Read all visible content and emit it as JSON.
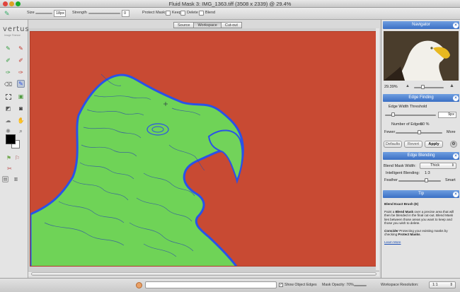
{
  "window": {
    "title": "Fluid Mask 3: IMG_1363.tiff (3508 x 2339) @ 29.4%"
  },
  "options_bar": {
    "size_label": "Size",
    "size_value": "18px",
    "strength_label": "Strength",
    "strength_value": "0",
    "protect_mask_label": "Protect Mask:",
    "keep_label": "Keep",
    "delete_label": "Delete",
    "blend_label": "Blend"
  },
  "toolbox": {
    "logo": "vertus",
    "logo_sub": "Image Finesse",
    "tools": [
      "green-brush-icon",
      "red-brush-icon",
      "green-brush-alt-icon",
      "red-brush-alt-icon",
      "green-fill-icon",
      "red-fill-icon",
      "eraser-icon",
      "blend-brush-icon",
      "selection-icon",
      "patch-icon",
      "local-cutout-icon",
      "camera-icon",
      "smudge-icon",
      "hand-icon",
      "sparkle-icon",
      "zoom-icon"
    ]
  },
  "view_tabs": [
    {
      "label": "Source",
      "active": false
    },
    {
      "label": "Workspace",
      "active": true
    },
    {
      "label": "Cut-out",
      "active": false
    }
  ],
  "navigator": {
    "title": "Navigator",
    "zoom": "29.39%"
  },
  "edge_finding": {
    "title": "Edge Finding",
    "threshold_label": "Edge Width Threshold",
    "threshold_value": "9px",
    "threshold_level": 0.2,
    "edges_label": "Number of Edges:",
    "edges_value": "50 %",
    "edges_level": 0.5,
    "fewer": "Fewer",
    "more": "More",
    "defaults_button": "Defaults",
    "revert_button": "Revert",
    "apply_button": "Apply"
  },
  "edge_blending": {
    "title": "Edge Blending",
    "blend_width_label": "Blend Mask Width:",
    "blend_width_value": "Thick",
    "intelligent_label": "Intelligent Blending:",
    "intelligent_value": "1:3",
    "feather_label": "Feather",
    "smart_label": "Smart",
    "feather_level": 0.62
  },
  "tip": {
    "title": "Tip",
    "heading": "Blend Exact Brush (E)",
    "p1_a": "Paint a ",
    "p1_b": "Blend Mask",
    "p1_c": " over a precise area that will then be blended in the final cut-out. Blend Mask lies between those areas you want to keep and those you wish to delete.",
    "p2_a": "Consider",
    "p2_b": " Protecting your existing masks by checking ",
    "p2_c": "Protect Masks",
    "p2_d": ".",
    "link": "Learn More"
  },
  "status_bar": {
    "show_edges_label": "Show Object Edges",
    "show_edges_checked": true,
    "mask_opacity_label": "Mask Opacity: 70%",
    "workspace_res_label": "Workspace Resolution:",
    "workspace_res_value": "1:1",
    "progress": 0.0
  },
  "colors": {
    "canvas_bg": "#c84a33",
    "keep_mask": "#6fd357",
    "edge_blue": "#2a52e8",
    "panel_header": "#4a7fd0"
  }
}
